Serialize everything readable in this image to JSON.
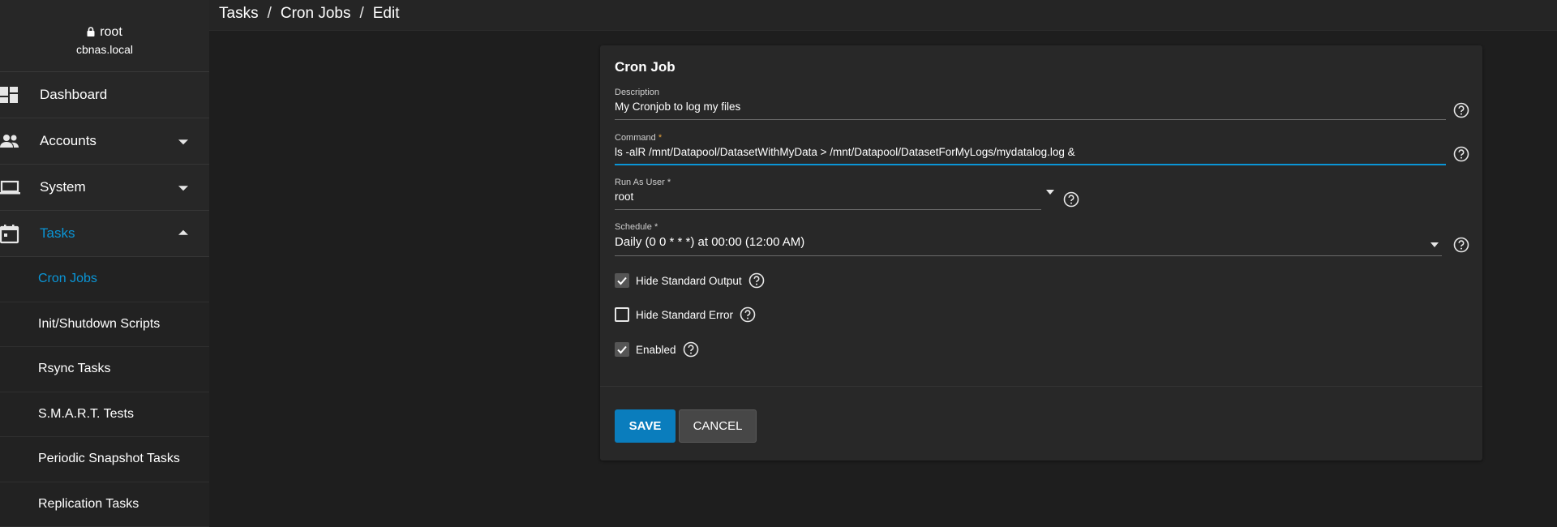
{
  "sidebar": {
    "user": "root",
    "host": "cbnas.local",
    "items": [
      {
        "label": "Dashboard",
        "icon": "dashboard-icon"
      },
      {
        "label": "Accounts",
        "icon": "people-icon"
      },
      {
        "label": "System",
        "icon": "laptop-icon"
      },
      {
        "label": "Tasks",
        "icon": "calendar-icon"
      }
    ],
    "subitems": [
      {
        "label": "Cron Jobs"
      },
      {
        "label": "Init/Shutdown Scripts"
      },
      {
        "label": "Rsync Tasks"
      },
      {
        "label": "S.M.A.R.T. Tests"
      },
      {
        "label": "Periodic Snapshot Tasks"
      },
      {
        "label": "Replication Tasks"
      }
    ]
  },
  "breadcrumb": [
    "Tasks",
    "Cron Jobs",
    "Edit"
  ],
  "breadcrumb_sep": "/",
  "form": {
    "title": "Cron Job",
    "description": {
      "label": "Description",
      "value": "My Cronjob to log my files"
    },
    "command": {
      "label": "Command",
      "required": "*",
      "value": "ls -alR /mnt/Datapool/DatasetWithMyData > /mnt/Datapool/DatasetForMyLogs/mydatalog.log &"
    },
    "user": {
      "label": "Run As User",
      "required": "*",
      "value": "root"
    },
    "schedule": {
      "label": "Schedule",
      "required": "*",
      "value": "Daily (0 0 * * *) at 00:00 (12:00 AM)"
    },
    "hide_stdout": {
      "label": "Hide Standard Output",
      "checked": true
    },
    "hide_stderr": {
      "label": "Hide Standard Error",
      "checked": false
    },
    "enabled": {
      "label": "Enabled",
      "checked": true
    }
  },
  "buttons": {
    "save": "SAVE",
    "cancel": "CANCEL"
  },
  "colors": {
    "accent": "#0a95d6",
    "save_button": "#0a7dbd",
    "background": "#1e1e1e",
    "card": "#282828"
  }
}
